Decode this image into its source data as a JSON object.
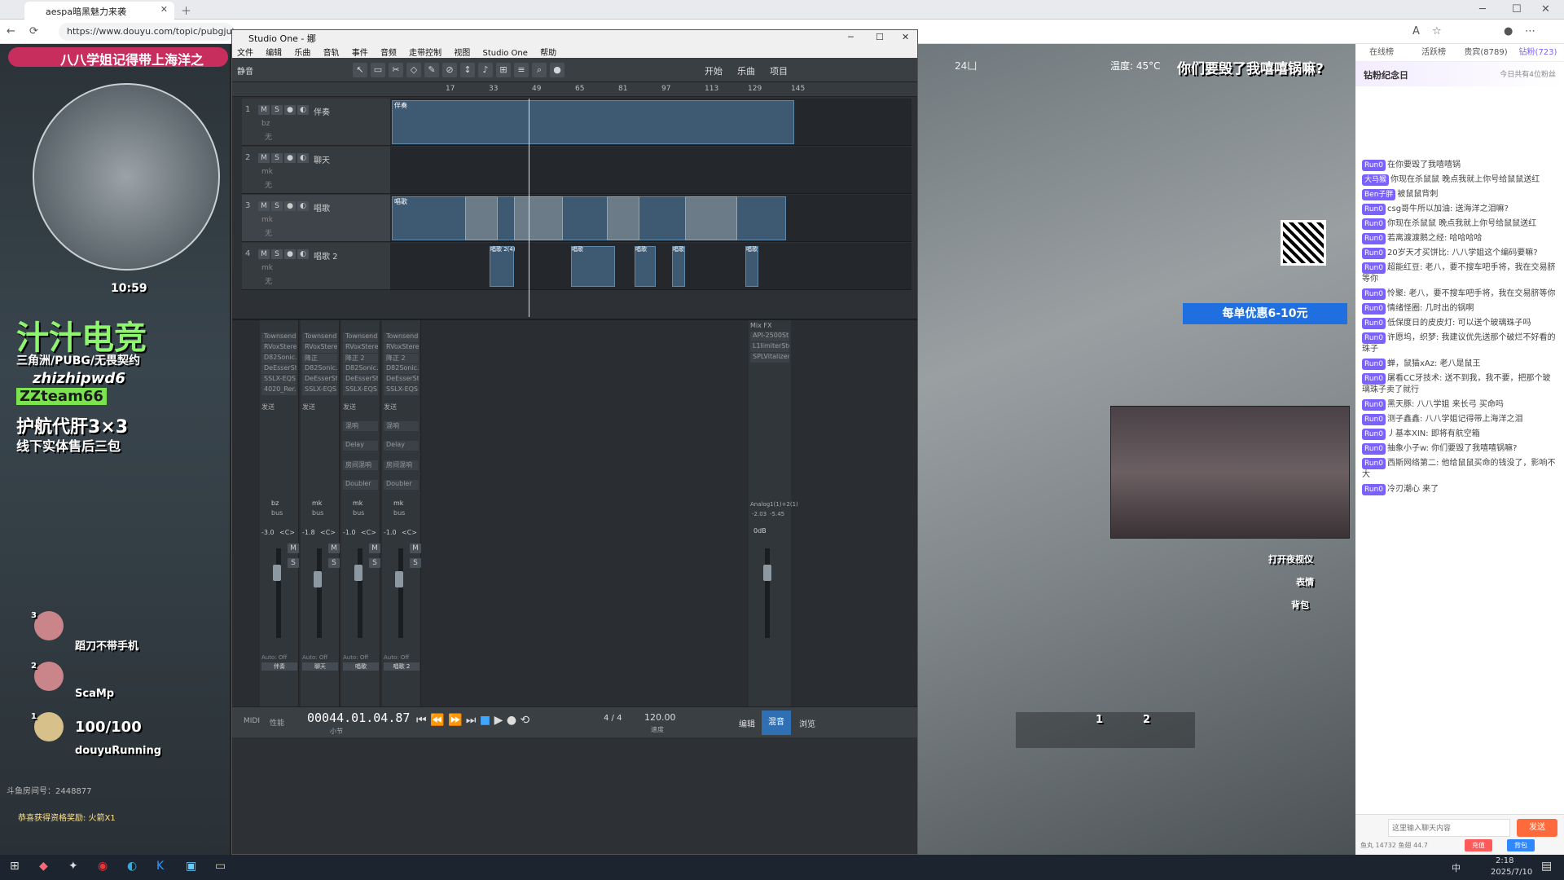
{
  "browser": {
    "tab_title": "aespa暗黑魅力来袭",
    "url": "https://www.douyu.com/topic/pubgjuly?r"
  },
  "stream_left": {
    "time": "10:59",
    "banner": "八八学姐记得带上海洋之",
    "brand": "汁汁电竞",
    "brand_sub": "三角洲/PUBG/无畏契约",
    "code1": "zhizhipwd6",
    "code2": "ZZteam66",
    "promo": "护航代肝3×3",
    "promo_sub": "线下实体售后三包",
    "players": [
      {
        "name": "蹈刀不带手机",
        "rank": "3"
      },
      {
        "name": "ScaMp",
        "rank": "2"
      },
      {
        "name": "douyuRunning",
        "rank": "1"
      }
    ],
    "health": "100/100",
    "room_id": "斗鱼房间号：2448877",
    "footer_note": "恭喜获得资格奖励: 火箭X1"
  },
  "stream_right": {
    "temp": "温度: 45°C",
    "headline": "你们要毁了我嘻嘻锅嘛?",
    "score": "24凵",
    "promo": "每单优惠6-10元",
    "hint_night": "打开夜视仪",
    "hint_emote": "表情",
    "hint_bag": "背包",
    "ammo1": "1",
    "ammo2": "2"
  },
  "chat": {
    "tabs": [
      "在线榜",
      "活跃榜",
      "贵宾(8789)",
      "钻粉(723)"
    ],
    "header": "钻粉纪念日",
    "sub": "今日共有4位粉丝",
    "lines": [
      {
        "user": "Run0",
        "text": "在你要毁了我嘻嘻锅"
      },
      {
        "user": "大马猴",
        "text": "你现在杀鼠鼠 晚点我就上你号给鼠鼠送红"
      },
      {
        "user": "Ben子胖",
        "text": "被鼠鼠背刺"
      },
      {
        "user": "Run0",
        "text": "csg哥牛所以加油: 送海洋之泪嘛?"
      },
      {
        "user": "Run0",
        "text": "你现在杀鼠鼠 晚点我就上你号给鼠鼠送红"
      },
      {
        "user": "Run0",
        "text": "若离渡渡鹅之经: 哈哈哈哈"
      },
      {
        "user": "Run0",
        "text": "20岁天才买饼比: 八八学姐这个编码要嘛?"
      },
      {
        "user": "Run0",
        "text": "超能红豆: 老八，要不搜车吧手将，我在交易脐等你"
      },
      {
        "user": "Run0",
        "text": "怜聚: 老八，要不搜车吧手将，我在交易脐等你"
      },
      {
        "user": "Run0",
        "text": "情绪怪圈: 几时出的锅啊"
      },
      {
        "user": "Run0",
        "text": "低保度日的皮皮灯: 可以送个玻璃珠子吗"
      },
      {
        "user": "Run0",
        "text": "许愿坞，织梦: 我建议优先送那个破烂不好看的珠子"
      },
      {
        "user": "Run0",
        "text": "蝉，鼠猫xAz: 老八是鼠王"
      },
      {
        "user": "Run0",
        "text": "屠看CC牙技术: 送不到我，我不要，把那个玻璃珠子卖了就行"
      },
      {
        "user": "Run0",
        "text": "黑天豚: 八八学姐 来长弓 买命吗"
      },
      {
        "user": "Run0",
        "text": "测子鑫鑫: 八八学姐记得带上海洋之泪"
      },
      {
        "user": "Run0",
        "text": "丿基本XIN: 即将有航空箱"
      },
      {
        "user": "Run0",
        "text": "抽象小子w: 你们要毁了我嘻嘻锅嘛?"
      },
      {
        "user": "Run0",
        "text": "西斯网络第二: 他给鼠鼠买命的钱没了，影响不大"
      },
      {
        "user": "Run0",
        "text": "冷刃潮心 来了"
      }
    ],
    "input_placeholder": "这里输入聊天内容",
    "send_label": "发送",
    "stats": "鱼丸 14732   鱼翅 44.7",
    "recharge": "充值",
    "bag": "背包"
  },
  "studio_one": {
    "title": "Studio One - 娜",
    "menu": [
      "文件",
      "编辑",
      "乐曲",
      "音轨",
      "事件",
      "音频",
      "走带控制",
      "视图",
      "Studio One",
      "帮助"
    ],
    "nav_tabs": [
      "开始",
      "乐曲",
      "项目"
    ],
    "preset": "静音",
    "ruler": [
      "17",
      "33",
      "49",
      "65",
      "81",
      "97",
      "113",
      "129",
      "145"
    ],
    "tracks": [
      {
        "num": "1",
        "name": "伴奏",
        "send": "bz",
        "input": "无"
      },
      {
        "num": "2",
        "name": "聊天",
        "send": "mk",
        "input": "无"
      },
      {
        "num": "3",
        "name": "唱歌",
        "send": "mk",
        "input": "无"
      },
      {
        "num": "4",
        "name": "唱歌 2",
        "send": "mk",
        "input": "无"
      }
    ],
    "clip_labels": {
      "track1": "伴奏",
      "track3": "唱歌",
      "track4": [
        "唱歌 2(4)",
        "唱歌",
        "唱",
        "唱歌",
        "唱歌",
        "唱歌",
        "唱歌",
        "唱歌"
      ]
    },
    "mixer": {
      "header_insert": "插入",
      "header_send": "发送",
      "channels": [
        {
          "label": "伴奏",
          "bus": "bz",
          "gain": "-3.0",
          "pan": "<C>",
          "inserts": [
            "Townsend..",
            "RVoxStereo",
            "D82Sonic..",
            "DeEsserSt..",
            "SSLX-EQS..",
            "4020_Rer.."
          ]
        },
        {
          "label": "聊天",
          "bus": "mk",
          "gain": "-1.8",
          "pan": "<C>",
          "inserts": [
            "Townsend..",
            "RVoxStereo",
            "降正",
            "D82Sonic..",
            "DeEsserSt..",
            "SSLX-EQS.."
          ]
        },
        {
          "label": "唱歌",
          "bus": "mk",
          "gain": "-1.0",
          "pan": "<C>",
          "inserts": [
            "Townsend..",
            "RVoxStereo",
            "降正 2",
            "D82Sonic..",
            "DeEsserSt..",
            "SSLX-EQS.."
          ]
        },
        {
          "label": "唱歌 2",
          "bus": "mk",
          "gain": "-1.0",
          "pan": "<C>",
          "inserts": [
            "Townsend..",
            "RVoxStereo",
            "降正 2",
            "D82Sonic..",
            "DeEsserSt..",
            "SSLX-EQS.."
          ]
        }
      ],
      "sends": [
        "混响",
        "Delay",
        "房间混响",
        "Doubler"
      ],
      "bus_label": "bus",
      "auto": "Auto: Off",
      "mixfx": "Mix FX",
      "mixfx_inserts": [
        "API-2500St..",
        "L1limiterSte..",
        "SPLVitalizer.."
      ],
      "analog": "Analog1(1)+2(1)",
      "main_gain": "-2.03",
      "main_gain2": "-5.45",
      "odb": "0dB"
    },
    "transport": {
      "time": "00044.01.04.87",
      "time_label": "小节",
      "sig": "4 / 4",
      "tempo": "120.00",
      "tempo_label": "速度",
      "midi": "MIDI",
      "perf": "性能",
      "tabs": [
        "编辑",
        "混音",
        "浏览"
      ]
    }
  },
  "taskbar": {
    "time": "2:18",
    "date": "2025/7/10",
    "lang": "中"
  }
}
